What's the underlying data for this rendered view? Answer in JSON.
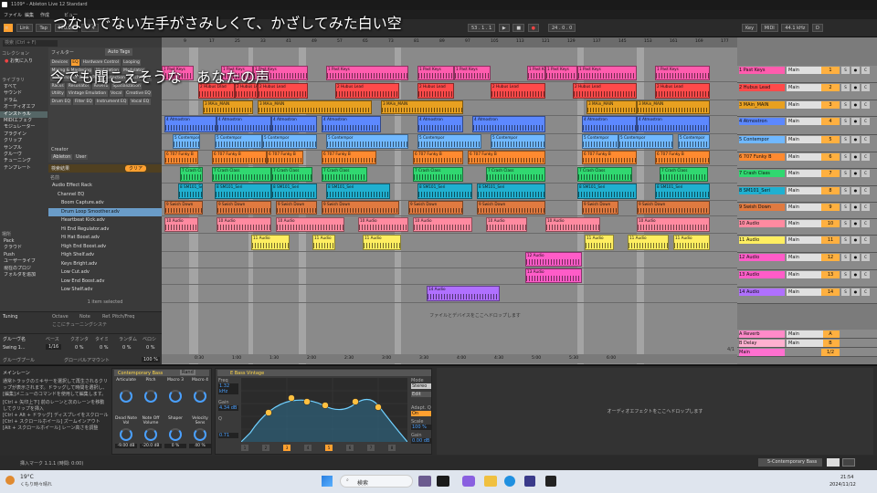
{
  "window": {
    "title": "1109* - Ableton Live 12 Standard"
  },
  "menu": [
    "ファイル",
    "編集",
    "作成",
    "ビュー",
    "オプション",
    "ヘルプ"
  ],
  "lyrics": [
    "つないでない左手がさみしくて、かざしてみた白い空",
    "今でも聞こえそうな　あなたの声"
  ],
  "transport": {
    "link": "Link",
    "tap": "Tap",
    "tempo": "120.00",
    "sig": "4 / 4",
    "position": "53 . 1 . 1",
    "length": "24 . 0 . 0",
    "key": "Key",
    "midi": "MIDI",
    "sample_rate": "44.1 kHz",
    "cpu": "D"
  },
  "browser": {
    "search_placeholder": "検索 (Ctrl + F)",
    "collection_heading": "コレクション",
    "favorite": "お気に入り",
    "library_heading": "ライブラリ",
    "categories": [
      "すべて",
      "サウンド",
      "ドラム",
      "オーディオエフ",
      "インストゥル",
      "MIDIエフェク",
      "モジュレーター",
      "プラグイン",
      "クリップ",
      "サンプル",
      "グルーヴ",
      "チューニング",
      "テンプレート"
    ],
    "places_heading": "場所",
    "places": [
      "Pack",
      "クラウド",
      "Push",
      "ユーザーライブ",
      "現在のプロジ",
      "フォルダを追加"
    ],
    "filter_label": "フィルター",
    "auto_tags": "Auto Tags",
    "tag_groups": [
      "Devices",
      "EQ",
      "Hardware Control",
      "Looping",
      "Mixing & Mastering",
      "Modulation",
      "Modulator",
      "Performance & DJ",
      "Pitch Correction",
      "Pitch Shift",
      "Racks",
      "Resonator",
      "Reverb",
      "Spatialization",
      "Utility",
      "Vintage Emulation",
      "Vocal",
      "Creative EQ",
      "Drum EQ",
      "Filter EQ",
      "Instrument EQ",
      "Vocal EQ"
    ],
    "creator_label": "Creator",
    "creators": [
      "Ableton",
      "User"
    ],
    "results_label": "検索結果",
    "clear": "クリア",
    "name_col": "名前",
    "folders": [
      "Audio Effect Rack",
      "Channel EQ"
    ],
    "results": [
      "Boom Capture.adv",
      "Drum Loop Smoother.adv",
      "Heartbeat Kick.adv",
      "Hi End Regulator.adv",
      "Hi Hat Boost.adv",
      "High End Boost.adv",
      "High Shelf.adv",
      "Keys Bright.adv",
      "Low Cut.adv",
      "Low End Boost.adv",
      "Low Shelf.adv"
    ],
    "selected_count": "1 item selected"
  },
  "tuning": {
    "title": "Tuning",
    "cols": [
      "Octave",
      "Note",
      "Ref. Pitch/Freq"
    ],
    "hint": "ここにチューニングシステ"
  },
  "groove": {
    "title": "グルーヴ名",
    "cols": [
      "ベース",
      "クオンタ",
      "タイミ",
      "ランダム",
      "ベロシ"
    ],
    "row": {
      "name": "Swing 1...",
      "base": "1/16",
      "q": "0 %",
      "t": "0 %",
      "r": "0 %",
      "v": "0 %"
    },
    "pool": "グルーヴプール",
    "global": "グローバルアマウント",
    "global_val": "100 %"
  },
  "ruler": [
    "9",
    "17",
    "25",
    "33",
    "41",
    "49",
    "57",
    "65",
    "73",
    "81",
    "89",
    "97",
    "105",
    "113",
    "121",
    "129",
    "137",
    "145",
    "153",
    "161",
    "169",
    "177"
  ],
  "timebar": [
    "0:30",
    "1:00",
    "1:30",
    "2:00",
    "2:30",
    "3:00",
    "3:30",
    "4:00",
    "4:30",
    "5:00",
    "5:30",
    "6:00"
  ],
  "drop_hint": "ファイルとデバイスをここへドロップします",
  "page_indicator": "4/1",
  "tracks": [
    {
      "name": "1 Past Keys",
      "color": "#ff5cae",
      "out": "Main",
      "num": "1"
    },
    {
      "name": "2 Hubus Lead",
      "color": "#ff4a4a",
      "out": "Main",
      "num": "2"
    },
    {
      "name": "3 MAin_MAIN",
      "color": "#e8a020",
      "out": "Main",
      "num": "3"
    },
    {
      "name": "4 Atmostron",
      "color": "#5c88ff",
      "out": "Main",
      "num": "4"
    },
    {
      "name": "5 Contempor",
      "color": "#70b8ff",
      "out": "Main",
      "num": "5"
    },
    {
      "name": "6 707 Funky B",
      "color": "#ff8a30",
      "out": "Main",
      "num": "6"
    },
    {
      "name": "7 Crash Class",
      "color": "#30d870",
      "out": "Main",
      "num": "7"
    },
    {
      "name": "8 SM101_Seri",
      "color": "#20b0d0",
      "out": "Main",
      "num": "8"
    },
    {
      "name": "9 Swish Down",
      "color": "#e07a40",
      "out": "Main",
      "num": "9"
    },
    {
      "name": "10 Audio",
      "color": "#ff8aa0",
      "out": "Main",
      "num": "10"
    },
    {
      "name": "11 Audio",
      "color": "#ffee60",
      "out": "Main",
      "num": "11"
    },
    {
      "name": "12 Audio",
      "color": "#ff5cc8",
      "out": "Main",
      "num": "12"
    },
    {
      "name": "13 Audio",
      "color": "#ff5cc8",
      "out": "Main",
      "num": "13"
    },
    {
      "name": "14 Audio",
      "color": "#b070ff",
      "out": "Main",
      "num": "14"
    }
  ],
  "returns": [
    {
      "name": "A Reverb",
      "color": "#ff8ac8",
      "num": "A",
      "out": "Main"
    },
    {
      "name": "B Delay",
      "color": "#ffb0d0",
      "num": "B",
      "out": "Main"
    },
    {
      "name": "Main",
      "color": "#ff70d0",
      "num": "1/2",
      "out": ""
    }
  ],
  "main_lane": {
    "title": "メインレーン",
    "help": "通常トラックのミキサーを選択して再生されるクリップが表示されます。ドラッグして時間を選択し、[編集]メニューのコマンドを使用して編集します。",
    "shortcuts": [
      "[Ctrl + 矢印上下] 前のレーンと次のレーンを移動してクリップを挿入",
      "[Ctrl + Alt + ドラッグ] ディスプレイをスクロール",
      "[Ctrl + スクロールホイール] ズームインアウト",
      "[Alt + スクロールホイール] レーン高さを調整"
    ]
  },
  "rack": {
    "name": "Contemporary Bass",
    "rand": "Rand",
    "macros": [
      {
        "label": "Articulate",
        "val": ""
      },
      {
        "label": "Pitch",
        "val": ""
      },
      {
        "label": "Macro 3",
        "val": ""
      },
      {
        "label": "Macro 4",
        "val": ""
      },
      {
        "label": "Dead Note Vol",
        "val": "-9.00 dB"
      },
      {
        "label": "Note Off Volume",
        "val": "-20.0 dB"
      },
      {
        "label": "Shaper",
        "val": "0 %"
      },
      {
        "label": "Velocity Sens",
        "val": "40 %"
      }
    ]
  },
  "eq": {
    "name": "E Bass Vintage",
    "freq_label": "Freq",
    "freq": "1.32 kHz",
    "gain_label": "Gain",
    "gain": "4.34 dB",
    "q_label": "Q",
    "q": "0.71",
    "mode_label": "Mode",
    "mode": "Stereo",
    "edit": "Edit",
    "adapt": "Adapt. Q",
    "adapt_val": "On",
    "scale_label": "Scale",
    "scale": "100 %",
    "out_gain_label": "Gain",
    "out_gain": "0.00 dB",
    "bands": [
      "1",
      "2",
      "3",
      "4",
      "5",
      "6",
      "7",
      "8"
    ],
    "freq_ticks": [
      "100",
      "1k",
      "10k"
    ],
    "db_ticks": [
      "12",
      "6",
      "0",
      "-6",
      "-12"
    ]
  },
  "fx_drop": "オーディオエフェクトをここへドロップします",
  "status": {
    "left": "挿入マーク 1.1.1 (時間: 0:00)",
    "track": "5-Contemporary Bass"
  },
  "taskbar": {
    "weather_temp": "19°C",
    "weather_desc": "くもり時々晴れ",
    "search": "検索",
    "time": "21:54",
    "date": "2024/11/12"
  }
}
